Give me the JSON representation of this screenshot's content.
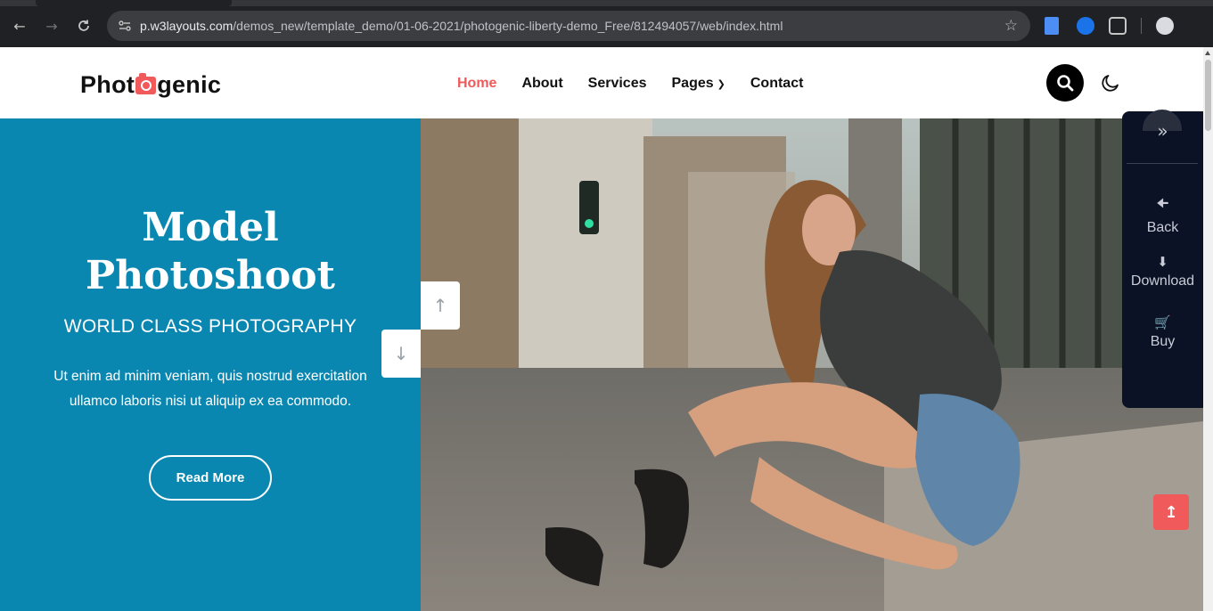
{
  "browser": {
    "url_host": "p.w3layouts.com",
    "url_path": "/demos_new/template_demo/01-06-2021/photogenic-liberty-demo_Free/812494057/web/index.html",
    "icons": [
      "back-icon",
      "forward-icon",
      "reload-icon",
      "site-info-icon",
      "bookmark-star-icon",
      "extension-icon",
      "profile-icon"
    ]
  },
  "header": {
    "logo_before": "Phot",
    "logo_after": "genic",
    "nav": [
      {
        "label": "Home",
        "active": true
      },
      {
        "label": "About"
      },
      {
        "label": "Services"
      },
      {
        "label": "Pages",
        "dropdown": true
      },
      {
        "label": "Contact"
      }
    ]
  },
  "hero": {
    "title_line1": "Model",
    "title_line2": "Photoshoot",
    "subtitle": "WORLD CLASS PHOTOGRAPHY",
    "text": "Ut enim ad minim veniam, quis nostrud exercitation ullamco laboris nisi ut aliquip ex ea commodo.",
    "button": "Read More",
    "background_color": "#0a87b0"
  },
  "side_panel": {
    "items": [
      {
        "label": "Back",
        "icon": "arrow-left-icon"
      },
      {
        "label": "Download",
        "icon": "download-icon"
      },
      {
        "label": "Buy",
        "icon": "cart-icon"
      }
    ]
  },
  "colors": {
    "accent": "#f05a5b",
    "panel": "#0b1226"
  }
}
